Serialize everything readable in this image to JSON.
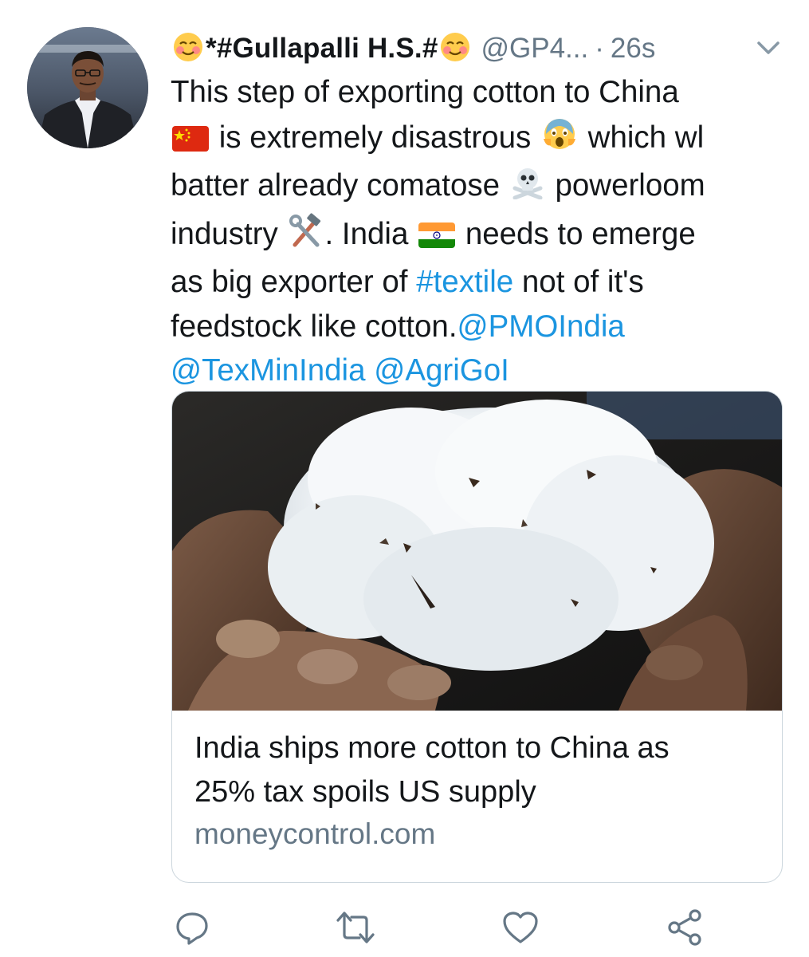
{
  "tweet": {
    "display_name": "*#Gullapalli H.S.#",
    "name_emoji": "smiling-face-with-blush",
    "handle": "@GP4...",
    "separator": "·",
    "timestamp": "26s",
    "body": {
      "l1": "This step of exporting cotton to China",
      "l2_a": "is extremely disastrous",
      "l2_b": "which wl",
      "l3_a": "batter already comatose",
      "l3_b": "powerloom",
      "l4_a": "industry",
      "l4_b": ". India",
      "l4_c": "needs to emerge",
      "l5_a": "as big exporter of",
      "l5_hashtag": "#textile",
      "l5_b": "not of it's",
      "l6_a": "feedstock like cotton.",
      "l6_mention": "@PMOIndia",
      "l7_mention1": "@TexMinIndia",
      "l7_mention2": "@AgriGoI"
    },
    "emojis": [
      "china-flag",
      "screaming-face",
      "skull-crossbones",
      "hammer-wrench",
      "india-flag"
    ]
  },
  "card": {
    "title_line1": "India ships more cotton to China as",
    "title_line2": "25% tax spoils US supply",
    "domain": "moneycontrol.com"
  },
  "actions": [
    "reply-icon",
    "retweet-icon",
    "like-icon",
    "share-icon"
  ],
  "colors": {
    "link": "#1b95e0",
    "secondary_text": "#657786",
    "border": "#ccd6dd"
  }
}
